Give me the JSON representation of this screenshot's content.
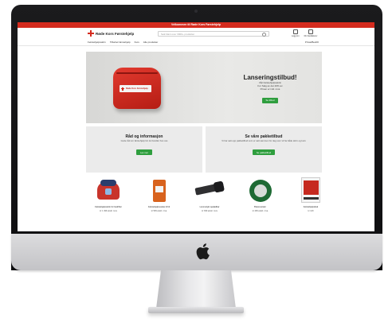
{
  "announcement": "Velkommen til Røde Kors Førstehjelp",
  "header": {
    "logo_text": "Røde Kors Førstehjelp",
    "search_placeholder": "Søk blant over 3000+ produkter",
    "account_label": "Logg inn",
    "cart_label": "Din handlekurv"
  },
  "nav": {
    "items": [
      "Førstehjelpsskrin",
      "Tilbehør førstehjelp",
      "Kurs",
      "Alle produkter"
    ],
    "right_link": "Privat/Bedrift"
  },
  "hero": {
    "title": "Lanseringstilbud!",
    "lines": [
      "Vårt førstehjelpsskrin",
      "For Salg av det 20% av",
      "Prisen er inkl. mva"
    ],
    "button": "Se tilbud"
  },
  "cards": [
    {
      "title": "Råd og informasjon",
      "text": "Gode råd om førstehjelp før du handler hos oss",
      "button": "Les mer"
    },
    {
      "title": "Se våre pakketilbud",
      "text": "Vi har satt opp pakketilbud som er satt sammen for deg som vil ha både skrin og kurs",
      "button": "Se pakketilbud"
    }
  ],
  "products": [
    {
      "name": "Førstehjelpsskrin for bedrifter",
      "price": "kr 1 499 ekskl. mva",
      "icon": "first-aid-kit-icon"
    },
    {
      "name": "Førstehjelpsveske til bil",
      "price": "kr 599 ekskl. mva",
      "icon": "first-aid-bag-icon"
    },
    {
      "name": "Lommelykt oppladbar",
      "price": "kr 399 ekskl. mva",
      "icon": "flashlight-icon"
    },
    {
      "name": "Brannvarsler",
      "price": "kr 499 ekskl. mva",
      "icon": "smoke-detector-icon"
    },
    {
      "name": "Førstehjelpsbok",
      "price": "kr 149",
      "icon": "book-icon"
    }
  ]
}
